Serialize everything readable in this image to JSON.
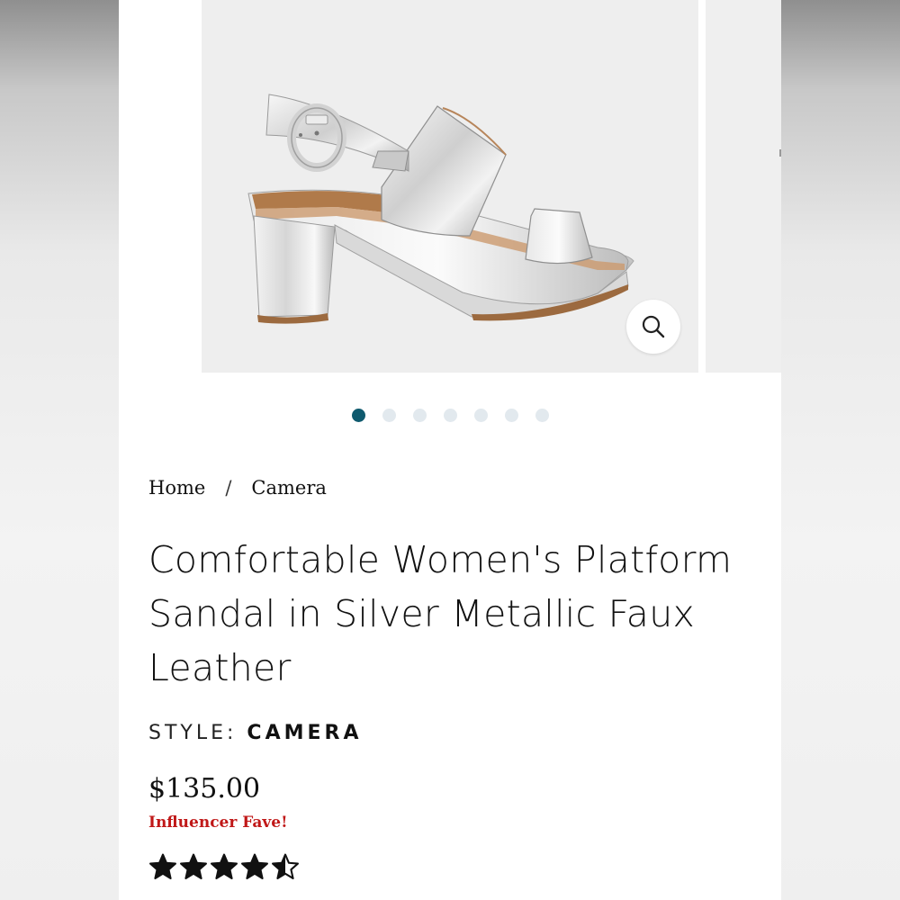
{
  "gallery": {
    "main_image": "silver-metallic-platform-sandal",
    "zoom_icon": "magnifier-icon",
    "total_slides": 7,
    "active_slide": 1
  },
  "breadcrumb": {
    "home": "Home",
    "separator": "/",
    "current": "Camera"
  },
  "product": {
    "title": "Comfortable Women's Platform Sandal in Silver Metallic Faux Leather",
    "style_label": "STYLE:",
    "style_value": "CAMERA",
    "price": "$135.00",
    "badge": "Influencer Fave!",
    "badge_color": "#c01818",
    "rating": 4.5,
    "rating_max": 5
  },
  "colors": {
    "accent": "#0f5a6e",
    "inactive_dot": "#e2e9ee"
  }
}
